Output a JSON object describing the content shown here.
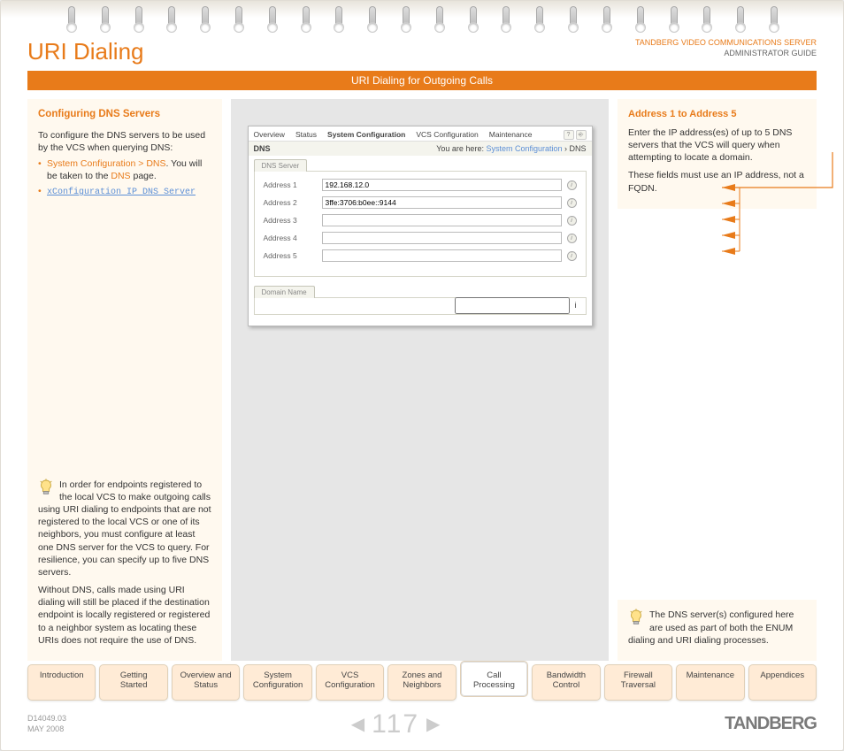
{
  "brand_top": {
    "a": "TANDBERG",
    "b": "VIDEO COMMUNICATIONS SERVER",
    "c": "ADMINISTRATOR GUIDE"
  },
  "page_title": "URI Dialing",
  "section_bar": "URI Dialing for Outgoing Calls",
  "left": {
    "heading": "Configuring DNS Servers",
    "intro": "To configure the DNS servers to be used by the VCS when querying DNS:",
    "bul1_a": "System Configuration > DNS",
    "bul1_b": ". You will be taken to the ",
    "bul1_c": "DNS",
    "bul1_d": " page.",
    "bul2": "xConfiguration IP DNS Server",
    "note1": "In order for endpoints registered to the local VCS to make outgoing calls using URI dialing to endpoints that are not registered to the local VCS or one of its neighbors, you must configure at least one DNS server for the VCS to query. For resilience, you can specify up to five DNS servers.",
    "note2": "Without DNS, calls made using URI dialing will still be placed if the destination endpoint is locally registered or registered to a neighbor system as locating these URIs does not require the use of DNS."
  },
  "shot": {
    "tabs": [
      "Overview",
      "Status",
      "System Configuration",
      "VCS Configuration",
      "Maintenance"
    ],
    "subtitle": "DNS",
    "breadcrumb_a": "You are here: ",
    "breadcrumb_b": "System Configuration",
    "breadcrumb_c": " › DNS",
    "group1": "DNS Server",
    "rows": [
      {
        "label": "Address 1",
        "value": "192.168.12.0"
      },
      {
        "label": "Address 2",
        "value": "3ffe:3706:b0ee::9144"
      },
      {
        "label": "Address 3",
        "value": ""
      },
      {
        "label": "Address 4",
        "value": ""
      },
      {
        "label": "Address 5",
        "value": ""
      }
    ],
    "group2": "Domain Name"
  },
  "right": {
    "heading": "Address 1 to Address 5",
    "p1": "Enter the IP address(es) of up to 5 DNS servers that the VCS will query when attempting to locate a domain.",
    "p2": "These fields must use an IP address, not a FQDN.",
    "note": "The DNS server(s) configured here are used as part of both the ENUM dialing and URI dialing processes."
  },
  "nav": [
    "Introduction",
    "Getting Started",
    "Overview and Status",
    "System Configuration",
    "VCS Configuration",
    "Zones and Neighbors",
    "Call Processing",
    "Bandwidth Control",
    "Firewall Traversal",
    "Maintenance",
    "Appendices"
  ],
  "nav_active": 6,
  "footer": {
    "docid": "D14049.03",
    "date": "MAY 2008",
    "page": "117",
    "brand": "TANDBERG"
  }
}
